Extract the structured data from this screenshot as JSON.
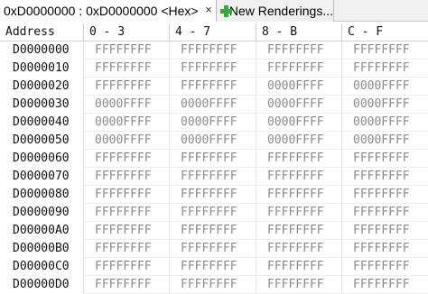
{
  "tabs": {
    "active_label": "0xD0000000 : 0xD0000000 <Hex>",
    "close_glyph": "×",
    "new_label": "New Renderings..."
  },
  "columns": {
    "address": "Address",
    "c0": "0 - 3",
    "c1": "4 - 7",
    "c2": "8 - B",
    "c3": "C - F"
  },
  "rows": [
    {
      "addr": "D0000000",
      "v": [
        "FFFFFFFF",
        "FFFFFFFF",
        "FFFFFFFF",
        "FFFFFFFF"
      ]
    },
    {
      "addr": "D0000010",
      "v": [
        "FFFFFFFF",
        "FFFFFFFF",
        "FFFFFFFF",
        "FFFFFFFF"
      ]
    },
    {
      "addr": "D0000020",
      "v": [
        "FFFFFFFF",
        "FFFFFFFF",
        "0000FFFF",
        "0000FFFF"
      ]
    },
    {
      "addr": "D0000030",
      "v": [
        "0000FFFF",
        "0000FFFF",
        "0000FFFF",
        "0000FFFF"
      ]
    },
    {
      "addr": "D0000040",
      "v": [
        "0000FFFF",
        "0000FFFF",
        "0000FFFF",
        "0000FFFF"
      ]
    },
    {
      "addr": "D0000050",
      "v": [
        "0000FFFF",
        "0000FFFF",
        "0000FFFF",
        "0000FFFF"
      ]
    },
    {
      "addr": "D0000060",
      "v": [
        "FFFFFFFF",
        "FFFFFFFF",
        "FFFFFFFF",
        "FFFFFFFF"
      ]
    },
    {
      "addr": "D0000070",
      "v": [
        "FFFFFFFF",
        "FFFFFFFF",
        "FFFFFFFF",
        "FFFFFFFF"
      ]
    },
    {
      "addr": "D0000080",
      "v": [
        "FFFFFFFF",
        "FFFFFFFF",
        "FFFFFFFF",
        "FFFFFFFF"
      ]
    },
    {
      "addr": "D0000090",
      "v": [
        "FFFFFFFF",
        "FFFFFFFF",
        "FFFFFFFF",
        "FFFFFFFF"
      ]
    },
    {
      "addr": "D00000A0",
      "v": [
        "FFFFFFFF",
        "FFFFFFFF",
        "FFFFFFFF",
        "FFFFFFFF"
      ]
    },
    {
      "addr": "D00000B0",
      "v": [
        "FFFFFFFF",
        "FFFFFFFF",
        "FFFFFFFF",
        "FFFFFFFF"
      ]
    },
    {
      "addr": "D00000C0",
      "v": [
        "FFFFFFFF",
        "FFFFFFFF",
        "FFFFFFFF",
        "FFFFFFFF"
      ]
    },
    {
      "addr": "D00000D0",
      "v": [
        "FFFFFFFF",
        "FFFFFFFF",
        "FFFFFFFF",
        "FFFFFFFF"
      ]
    }
  ],
  "colors": {
    "value_text": "#8a8a8a",
    "add_icon": "#3fa63f"
  },
  "icons": {
    "close": "close-icon",
    "add": "plus-icon"
  }
}
